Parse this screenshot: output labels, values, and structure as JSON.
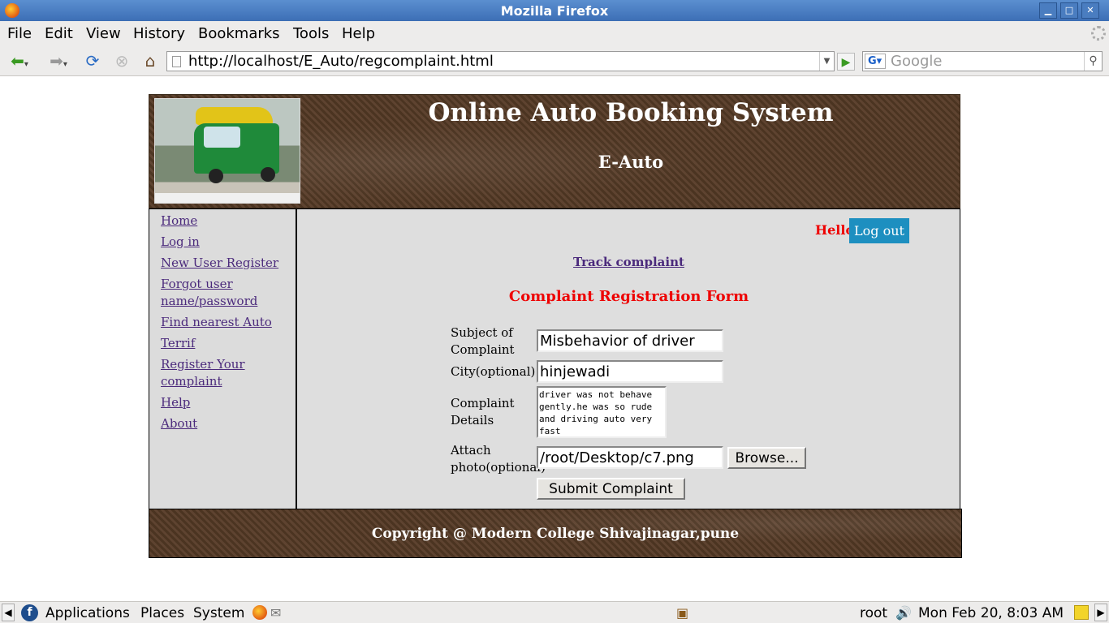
{
  "window": {
    "title": "Mozilla Firefox"
  },
  "menu": [
    "File",
    "Edit",
    "View",
    "History",
    "Bookmarks",
    "Tools",
    "Help"
  ],
  "address": {
    "url": "http://localhost/E_Auto/regcomplaint.html"
  },
  "search": {
    "placeholder": "Google"
  },
  "site": {
    "title": "Online Auto Booking System",
    "subtitle": "E-Auto",
    "nav": [
      "Home",
      "Log in",
      "New User Register",
      "Forgot user name/password",
      "Find nearest Auto",
      "Terrif",
      "Register Your complaint",
      "Help",
      "About"
    ],
    "hello": "Hello",
    "logout": "Log out",
    "track": "Track complaint",
    "form_title": "Complaint Registration Form",
    "fields": {
      "subject_label": "Subject of Complaint",
      "subject_value": "Misbehavior of driver",
      "city_label": "City(optional)",
      "city_value": "hinjewadi",
      "details_label": "Complaint Details",
      "details_value": "driver was not behave gently.he was so rude and driving auto very fast",
      "photo_label": "Attach photo(optional)",
      "photo_value": "/root/Desktop/c7.png",
      "browse": "Browse...",
      "submit": "Submit Complaint"
    },
    "footer": "Copyright @ Modern College Shivajinagar,pune"
  },
  "taskbar": {
    "applications": "Applications",
    "places": "Places",
    "system": "System",
    "user": "root",
    "clock": "Mon Feb 20,  8:03 AM"
  }
}
